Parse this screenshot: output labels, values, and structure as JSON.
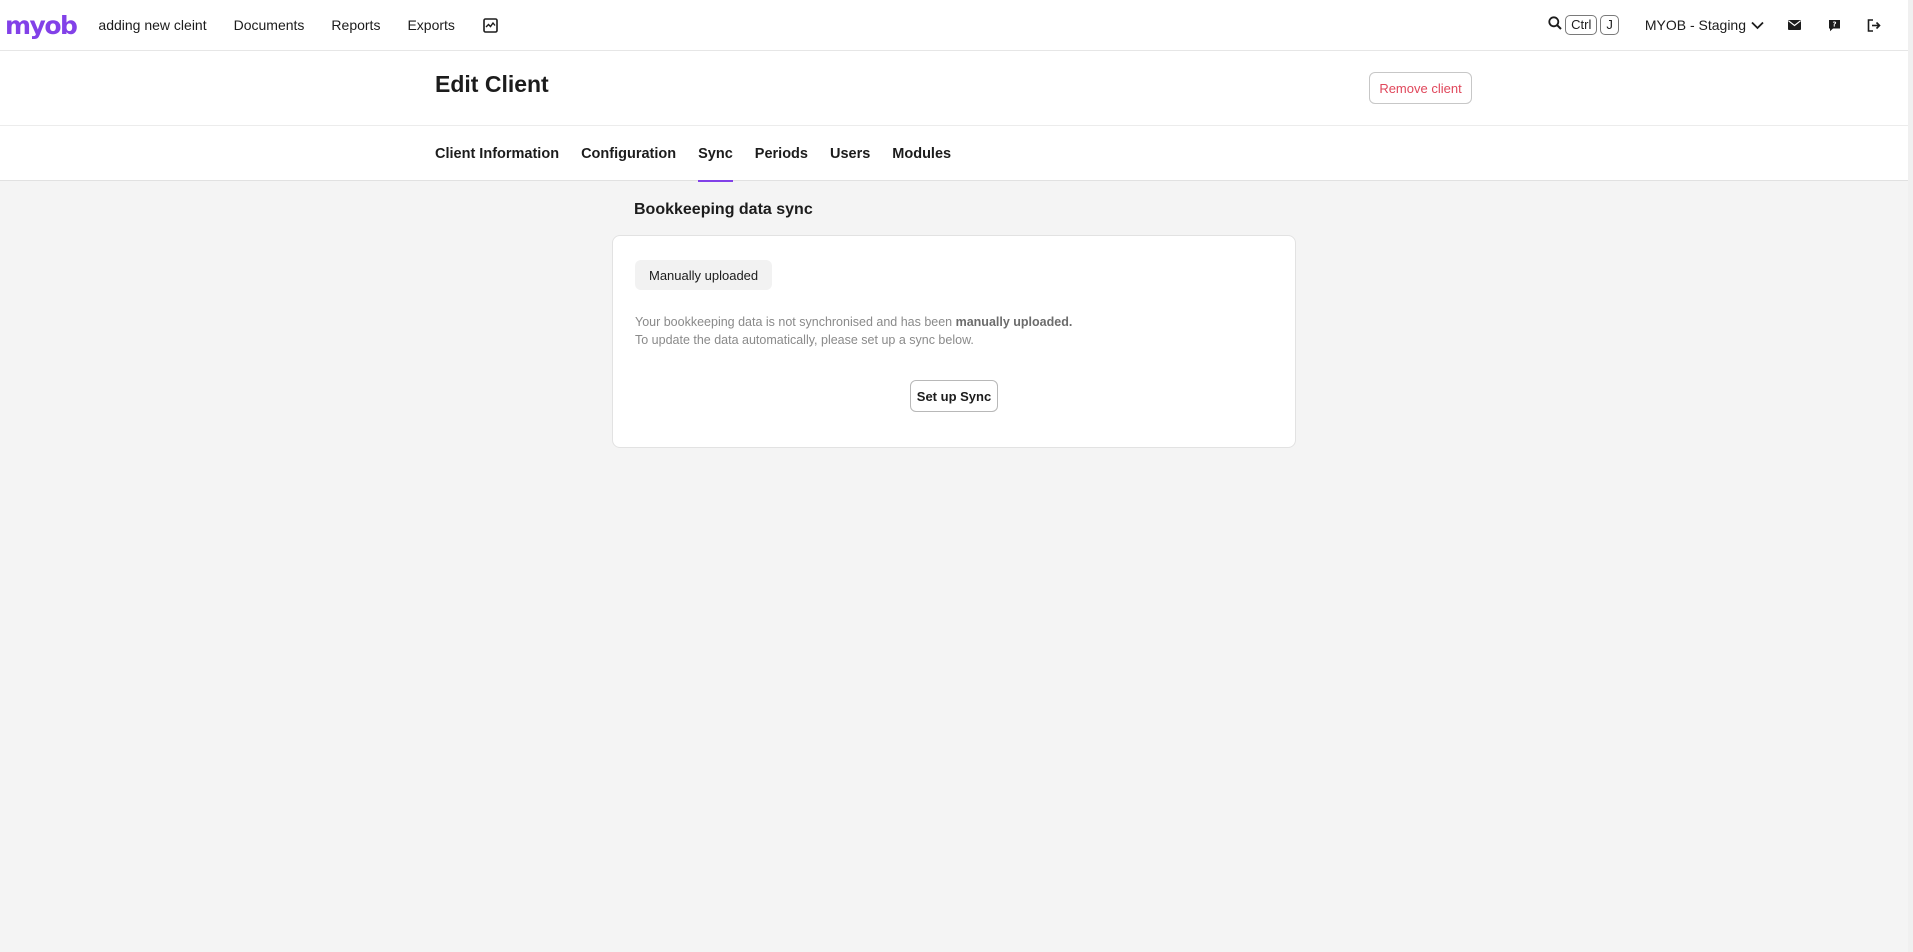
{
  "nav": {
    "logo": "myob",
    "links": [
      "adding new cleint",
      "Documents",
      "Reports",
      "Exports"
    ],
    "icon_after_links": "activity-chart-icon",
    "search_icon": "search-icon",
    "shortcut_keys": [
      "Ctrl",
      "J"
    ],
    "org_name": "MYOB - Staging",
    "org_dropdown_icon": "chevron-down-icon",
    "right_icons": [
      "mail-icon",
      "feedback-icon",
      "logout-icon"
    ]
  },
  "header": {
    "title": "Edit Client",
    "remove_label": "Remove client"
  },
  "tabs": {
    "items": [
      "Client Information",
      "Configuration",
      "Sync",
      "Periods",
      "Users",
      "Modules"
    ],
    "active": "Sync"
  },
  "sync": {
    "section_title": "Bookkeeping data sync",
    "status": "Manually uploaded",
    "desc_line1_prefix": "Your bookkeeping data is not synchronised and has been ",
    "desc_line1_bold": "manually uploaded.",
    "desc_line2": "To update the data automatically, please set up a sync below.",
    "setup_label": "Set up Sync"
  },
  "colors": {
    "brand": "#8241e8",
    "danger": "#e0475b",
    "background": "#f4f4f4"
  }
}
